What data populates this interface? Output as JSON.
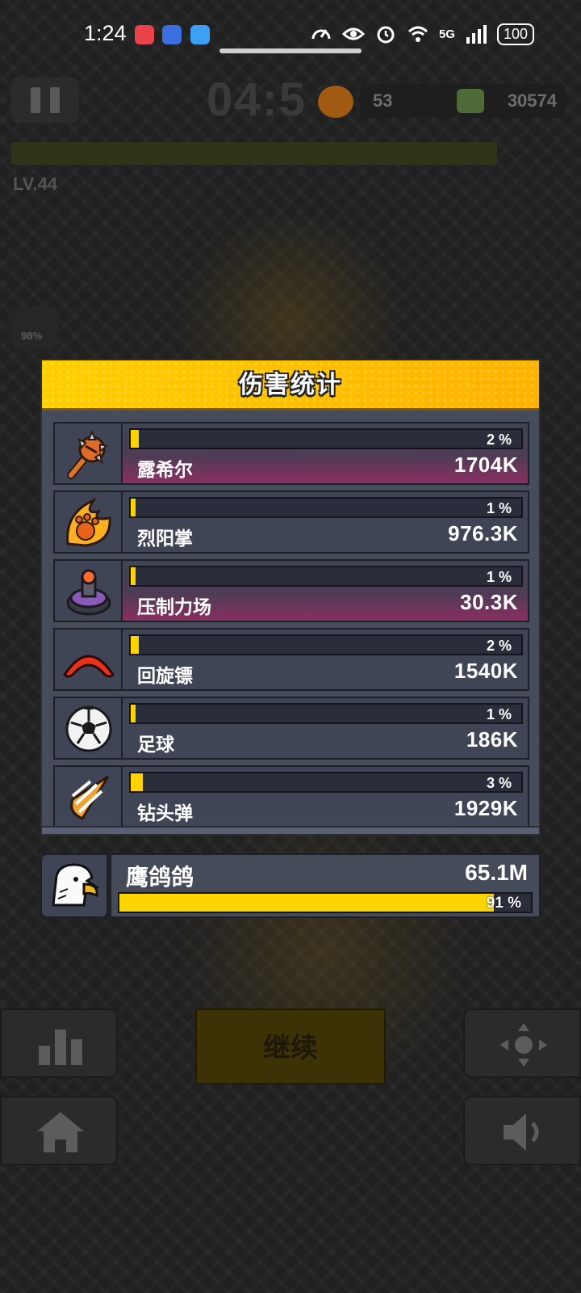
{
  "status_bar": {
    "time": "1:24",
    "battery": "100",
    "network": "5G"
  },
  "hud": {
    "timer": "04:5",
    "coins": "53",
    "kills": "30574",
    "level": "LV.44",
    "side_label": "98%"
  },
  "dialog": {
    "title": "伤害统计",
    "items": [
      {
        "name": "露希尔",
        "damage": "1704K",
        "percent": "2 %",
        "share": 0.02,
        "highlighted": true,
        "icon": "spiked-club-icon"
      },
      {
        "name": "烈阳掌",
        "damage": "976.3K",
        "percent": "1 %",
        "share": 0.01,
        "highlighted": false,
        "icon": "flaming-paw-icon"
      },
      {
        "name": "压制力场",
        "damage": "30.3K",
        "percent": "1 %",
        "share": 0.01,
        "highlighted": true,
        "icon": "force-field-device-icon"
      },
      {
        "name": "回旋镖",
        "damage": "1540K",
        "percent": "2 %",
        "share": 0.02,
        "highlighted": false,
        "icon": "boomerang-icon"
      },
      {
        "name": "足球",
        "damage": "186K",
        "percent": "1 %",
        "share": 0.01,
        "highlighted": false,
        "icon": "soccer-ball-icon"
      },
      {
        "name": "钻头弹",
        "damage": "1929K",
        "percent": "3 %",
        "share": 0.03,
        "highlighted": false,
        "icon": "drill-bullet-icon"
      }
    ],
    "player": {
      "name": "鹰鸽鸽",
      "damage": "65.1M",
      "percent": "91 %",
      "share": 0.91,
      "icon": "eagle-avatar-icon"
    }
  },
  "buttons": {
    "continue_label": "继续"
  },
  "colors": {
    "header_yellow": "#ffbe00",
    "bar_yellow": "#ffd200",
    "panel": "#3f4555",
    "highlight_magenta": "#8a2f62"
  }
}
